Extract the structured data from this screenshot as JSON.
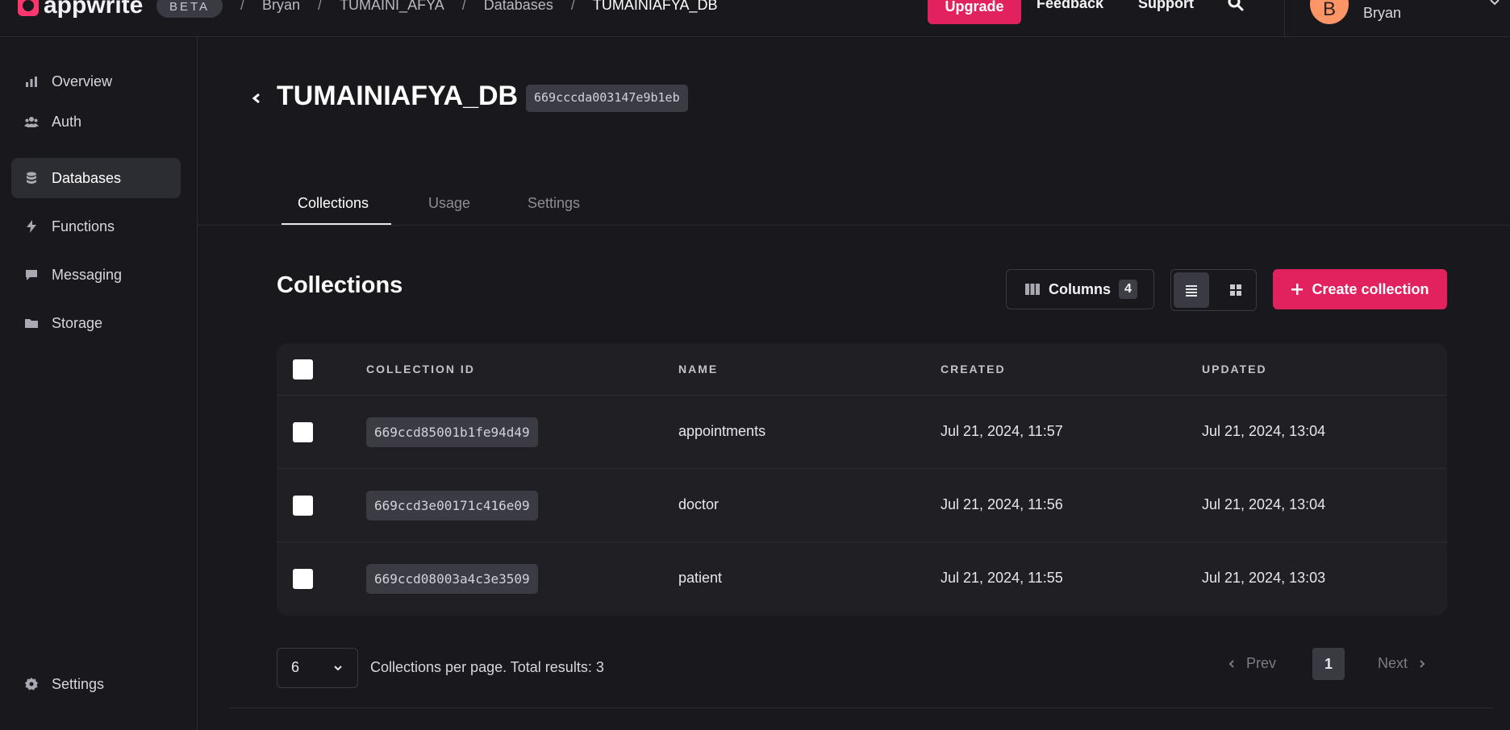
{
  "topbar": {
    "logo": "appwrite",
    "beta": "BETA",
    "breadcrumbs": [
      "Bryan",
      "TUMAINI_AFYA",
      "Databases",
      "TUMAINIAFYA_DB"
    ],
    "upgrade": "Upgrade",
    "feedback": "Feedback",
    "support": "Support",
    "search_icon": "search-icon",
    "avatar_initial": "B",
    "username": "Bryan"
  },
  "sidebar": {
    "items": [
      {
        "label": "Overview",
        "icon": "bar-chart-icon"
      },
      {
        "label": "Auth",
        "icon": "users-icon"
      },
      {
        "label": "Databases",
        "icon": "database-icon",
        "active": true
      },
      {
        "label": "Functions",
        "icon": "lightning-icon"
      },
      {
        "label": "Messaging",
        "icon": "chat-icon"
      },
      {
        "label": "Storage",
        "icon": "folder-icon"
      }
    ],
    "settings": "Settings"
  },
  "header": {
    "title": "TUMAINIAFYA_DB",
    "id": "669cccda003147e9b1eb"
  },
  "tabs": [
    "Collections",
    "Usage",
    "Settings"
  ],
  "collections": {
    "title": "Collections",
    "columns_label": "Columns",
    "columns_count": "4",
    "create_label": "Create collection",
    "headers": [
      "COLLECTION ID",
      "NAME",
      "CREATED",
      "UPDATED"
    ],
    "rows": [
      {
        "id": "669ccd85001b1fe94d49",
        "name": "appointments",
        "created": "Jul 21, 2024, 11:57",
        "updated": "Jul 21, 2024, 13:04"
      },
      {
        "id": "669ccd3e00171c416e09",
        "name": "doctor",
        "created": "Jul 21, 2024, 11:56",
        "updated": "Jul 21, 2024, 13:04"
      },
      {
        "id": "669ccd08003a4c3e3509",
        "name": "patient",
        "created": "Jul 21, 2024, 11:55",
        "updated": "Jul 21, 2024, 13:03"
      }
    ]
  },
  "pagination": {
    "per_page": "6",
    "summary": "Collections per page. Total results: 3",
    "prev": "Prev",
    "page": "1",
    "next": "Next"
  },
  "colors": {
    "accent": "#e1225e",
    "background": "#19191d",
    "avatar": "#fe9567"
  }
}
